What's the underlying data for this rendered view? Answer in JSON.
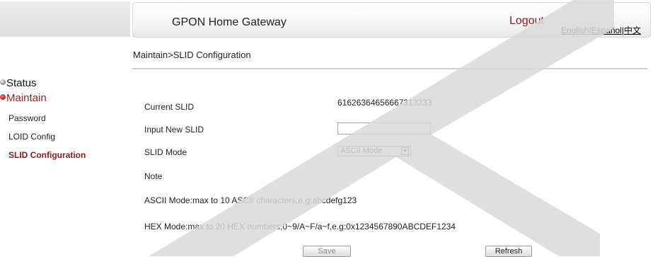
{
  "header": {
    "title": "GPON Home Gateway",
    "logout": "Logout",
    "lang_english": "English",
    "lang_sep1": "|",
    "lang_spanish": "Español",
    "lang_sep2": "|",
    "lang_chinese": "中文"
  },
  "breadcrumb": "Maintain>SLID Configuration",
  "sidebar": {
    "status": "Status",
    "maintain": "Maintain",
    "items": [
      {
        "label": "Password"
      },
      {
        "label": "LOID Config"
      },
      {
        "label": "SLID Configuration",
        "active": true
      }
    ]
  },
  "form": {
    "current_slid_label": "Current SLID",
    "current_slid_value": "61626364656667313233",
    "input_new_slid_label": "Input New SLID",
    "input_new_slid_value": "",
    "slid_mode_label": "SLID Mode",
    "slid_mode_value": "ASCII Mode",
    "note_label": "Note",
    "ascii_note": "ASCII Mode:max to 10 ASCII characters,e.g:abcdefg123",
    "hex_note": "HEX Mode:max to 20 HEX numbers,0~9/A~F/a~f,e.g:0x1234567890ABCDEF1234"
  },
  "buttons": {
    "save": "Save",
    "refresh": "Refresh"
  },
  "colors": {
    "accent": "#8b1a1a",
    "watermark": "#d9d9d9"
  }
}
